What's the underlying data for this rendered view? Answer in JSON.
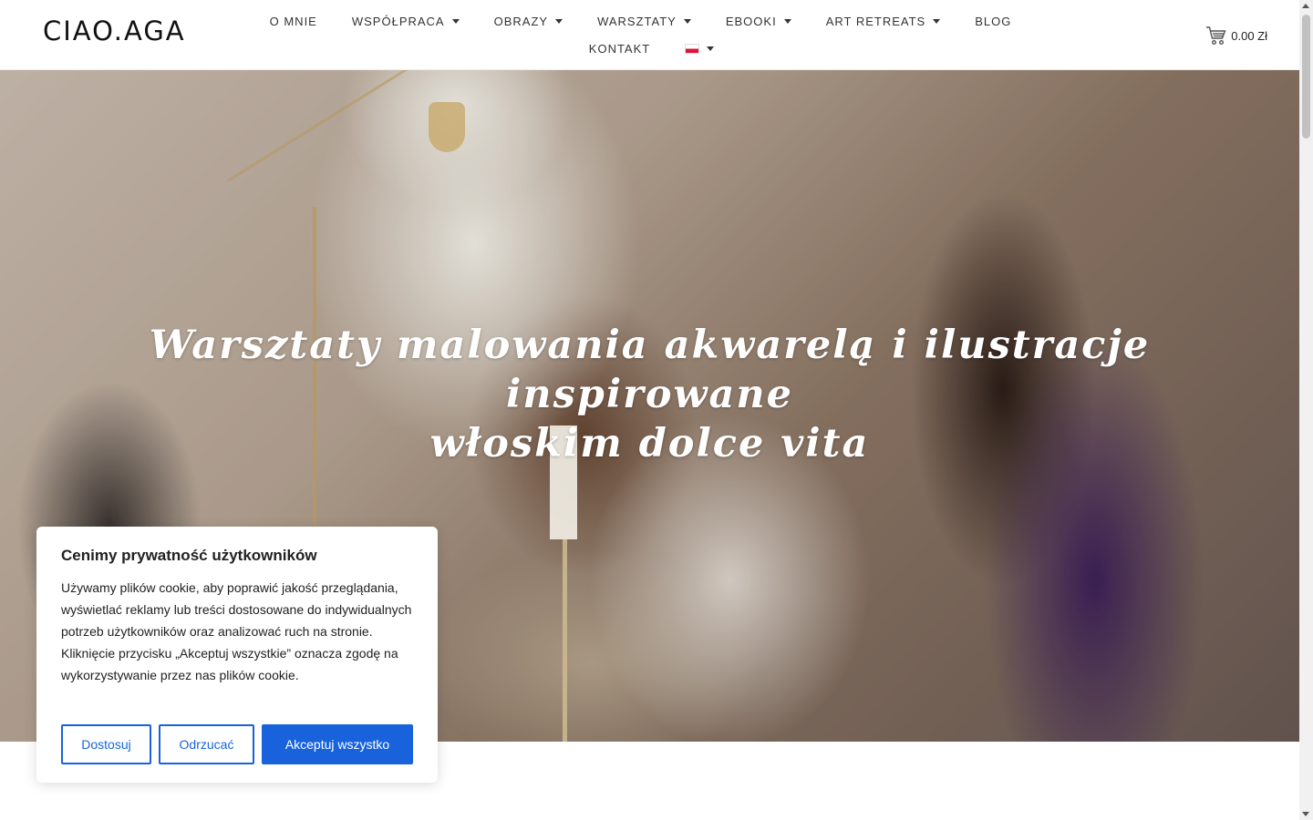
{
  "header": {
    "logo": "CIAO.AGA",
    "nav": [
      {
        "label": "O MNIE",
        "dropdown": false
      },
      {
        "label": "WSPÓŁPRACA",
        "dropdown": true
      },
      {
        "label": "OBRAZY",
        "dropdown": true
      },
      {
        "label": "WARSZTATY",
        "dropdown": true
      },
      {
        "label": "EBOOKI",
        "dropdown": true
      },
      {
        "label": "ART RETREATS",
        "dropdown": true
      },
      {
        "label": "BLOG",
        "dropdown": false
      }
    ],
    "nav_row2": [
      {
        "label": "KONTAKT",
        "dropdown": false
      }
    ],
    "language_flag": "poland-flag-icon",
    "cart": {
      "icon": "cart-icon",
      "amount": "0.00 Zł"
    }
  },
  "hero": {
    "title_line1": "Warsztaty malowania akwarelą i ilustracje inspirowane",
    "title_line2": "włoskim dolce vita"
  },
  "cookie_banner": {
    "title": "Cenimy prywatność użytkowników",
    "text": "Używamy plików cookie, aby poprawić jakość przeglądania, wyświetlać reklamy lub treści dostosowane do indywidualnych potrzeb użytkowników oraz analizować ruch na stronie. Kliknięcie przycisku „Akceptuj wszystkie” oznacza zgodę na wykorzystywanie przez nas plików cookie.",
    "buttons": {
      "customize": "Dostosuj",
      "reject": "Odrzucać",
      "accept": "Akceptuj wszystko"
    }
  },
  "colors": {
    "accent": "#1863dc",
    "text": "#212121"
  }
}
